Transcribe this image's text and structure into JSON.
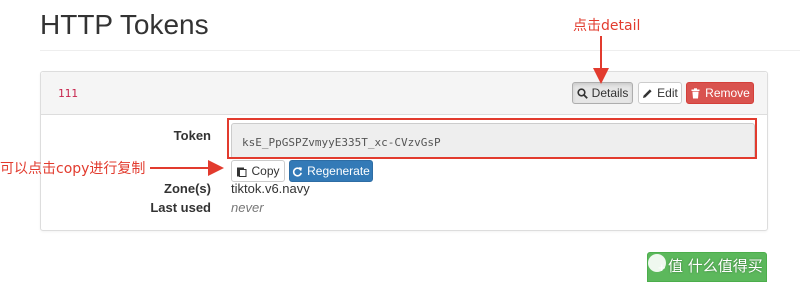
{
  "page": {
    "title": "HTTP Tokens"
  },
  "token": {
    "name": "111",
    "field_label": "Token",
    "value": "ksE_PpGSPZvmyyE335T_xc-CVzvGsP",
    "zones_label": "Zone(s)",
    "zones_value": "tiktok.v6.navy",
    "last_used_label": "Last used",
    "last_used_value": "never"
  },
  "buttons": {
    "details": "Details",
    "edit": "Edit",
    "remove": "Remove",
    "copy": "Copy",
    "regenerate": "Regenerate",
    "add": "+"
  },
  "annotations": {
    "detail_hint": "点击detail",
    "copy_hint": "可以点击copy进行复制"
  },
  "watermark": {
    "text": "值 什么值得买"
  },
  "colors": {
    "annotation": "#e23b2e",
    "danger": "#d9534f",
    "primary": "#337ab7",
    "success": "#5cb85c",
    "token_name": "#c7254e"
  },
  "icons": {
    "details": "search-icon",
    "edit": "pencil-icon",
    "remove": "trash-icon",
    "copy": "clipboard-icon",
    "regenerate": "refresh-icon"
  }
}
